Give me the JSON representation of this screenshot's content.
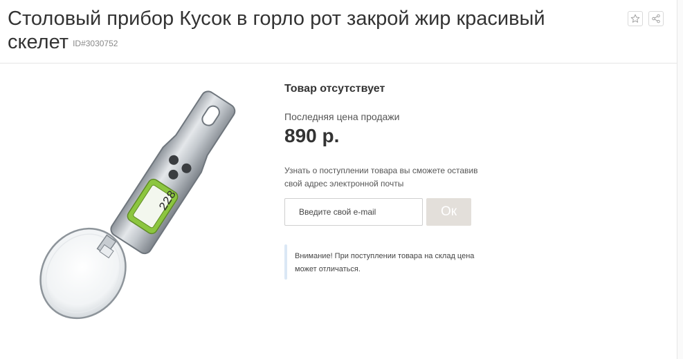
{
  "product": {
    "title": "Столовый прибор Кусок в горло рот закрой жир красивый скелет",
    "id_label": "ID#3030752",
    "image_display_digits": "228"
  },
  "actions": {
    "favorite_icon": "star-icon",
    "share_icon": "share-icon"
  },
  "availability": {
    "status": "Товар отсутствует",
    "last_price_label": "Последняя цена продажи",
    "price": "890 р."
  },
  "notify": {
    "description": "Узнать о поступлении товара вы сможете оставив свой адрес электронной почты",
    "email_placeholder": "Введите свой e-mail",
    "email_value": "",
    "submit_label": "Ок",
    "notice": "Внимание! При поступлении товара на склад цена может отличаться."
  },
  "colors": {
    "submit_button": "#e3dfda",
    "notice_bar": "#dbe8f5",
    "lcd_green": "#8cc63f"
  }
}
